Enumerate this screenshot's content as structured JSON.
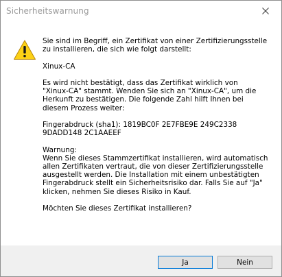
{
  "window": {
    "title": "Sicherheitswarnung"
  },
  "icons": {
    "warning": "warning-icon",
    "close": "close-icon"
  },
  "message": {
    "intro": "Sie sind im Begriff, ein Zertifikat von einer Zertifizierungsstelle\nzu installieren, die sich wie folgt darstellt:",
    "ca_name": "Xinux-CA",
    "verification": "Es wird nicht bestätigt, dass das Zertifikat wirklich von\n\"Xinux-CA\" stammt. Wenden Sie sich an \"Xinux-CA\", um die\nHerkunft zu bestätigen. Die folgende Zahl hilft Ihnen bei\ndiesem Prozess weiter:",
    "fingerprint": "Fingerabdruck (sha1): 1819BC0F 2E7FBE9E 249C2338\n9DADD148 2C1AAEEF",
    "warning": "Warnung:\nWenn Sie dieses Stammzertifikat installieren, wird automatisch\nallen Zertifikaten vertraut, die von dieser Zertifizierungsstelle\nausgestellt werden. Die Installation mit einem unbestätigten\nFingerabdruck stellt ein Sicherheitsrisiko dar. Falls Sie auf \"Ja\"\nklicken, nehmen Sie dieses Risiko in Kauf.",
    "question": "Möchten Sie dieses Zertifikat installieren?"
  },
  "buttons": {
    "yes_label": "Ja",
    "no_label": "Nein"
  },
  "colors": {
    "accent": "#0078d7",
    "warning_fill": "#fcd116",
    "footer_bg": "#f0f0f0"
  }
}
